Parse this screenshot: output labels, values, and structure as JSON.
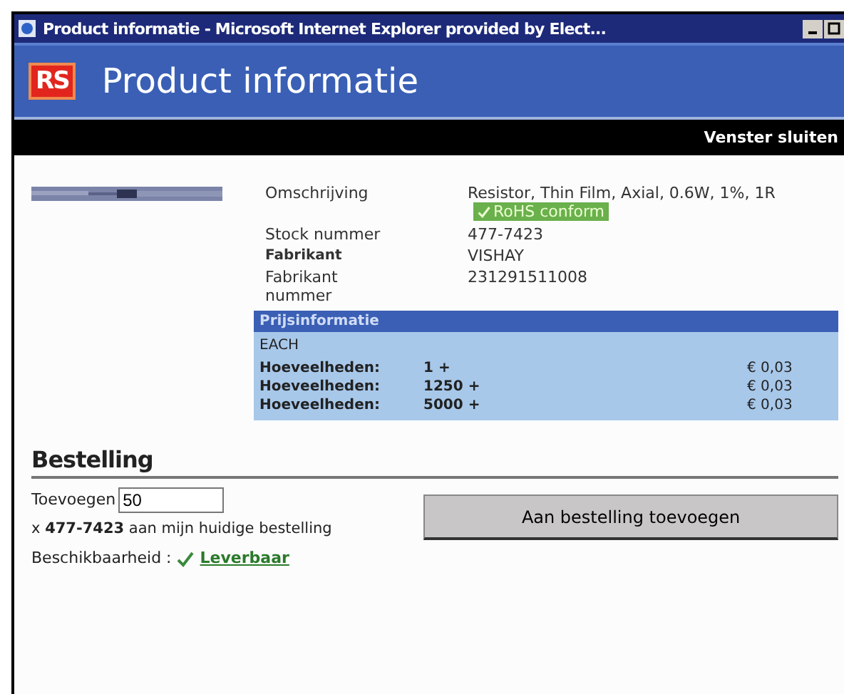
{
  "window": {
    "title": "Product informatie - Microsoft Internet Explorer provided by Elect..."
  },
  "header": {
    "logo": "RS",
    "title": "Product informatie"
  },
  "toolbar": {
    "close_link": "Venster sluiten"
  },
  "product": {
    "details": [
      {
        "label": "Omschrijving",
        "label_bold": false,
        "value": "Resistor, Thin Film, Axial, 0.6W, 1%, 1R",
        "badge": "RoHS conform"
      },
      {
        "label": "Stock nummer",
        "label_bold": false,
        "value": "477-7423"
      },
      {
        "label": "Fabrikant",
        "label_bold": true,
        "value": "VISHAY"
      },
      {
        "label": "Fabrikant nummer",
        "label_bold": false,
        "value": "231291511008"
      }
    ]
  },
  "prices": {
    "title": "Prijsinformatie",
    "unit": "EACH",
    "rows": [
      {
        "label": "Hoeveelheden:",
        "quantity": "1 +",
        "price": "€ 0,03"
      },
      {
        "label": "Hoeveelheden:",
        "quantity": "1250 +",
        "price": "€ 0,03"
      },
      {
        "label": "Hoeveelheden:",
        "quantity": "5000 +",
        "price": "€ 0,03"
      }
    ]
  },
  "order": {
    "title": "Bestelling",
    "add_label": "Toevoegen",
    "quantity": "50",
    "sentence": "x **477-7423** aan mijn huidige bestelling",
    "button": "Aan bestelling toevoegen",
    "availability_label": "Beschikbaarheid :",
    "availability": "Leverbaar"
  }
}
